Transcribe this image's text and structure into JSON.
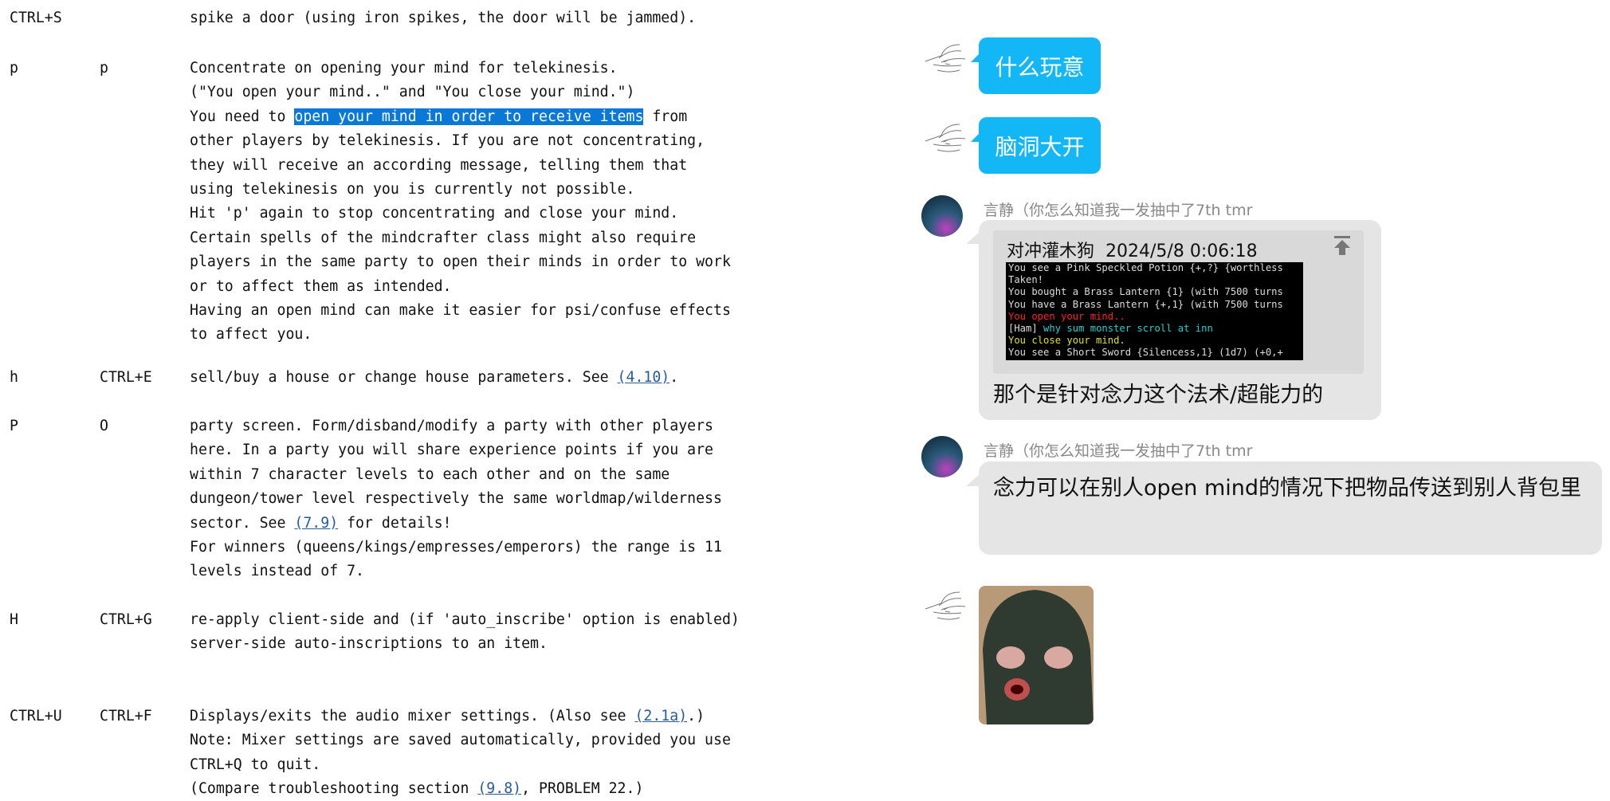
{
  "manual": {
    "sections": [
      {
        "key1": "CTRL+S",
        "key2": "",
        "lines": [
          [
            {
              "t": "spike a door (using iron spikes, the door will be jammed)."
            }
          ]
        ]
      },
      {
        "key1": "p",
        "key2": "p",
        "lines": [
          [
            {
              "t": "Concentrate on opening your mind for telekinesis."
            }
          ],
          [
            {
              "t": "(\"You open your mind..\" and \"You close your mind.\")"
            }
          ],
          [
            {
              "t": "You need to "
            },
            {
              "t": "open your mind in order to receive items",
              "type": "hl"
            },
            {
              "t": " from"
            }
          ],
          [
            {
              "t": "other players by telekinesis. If you are not concentrating,"
            }
          ],
          [
            {
              "t": "they will receive an according message, telling them that"
            }
          ],
          [
            {
              "t": "using telekinesis on you is currently not possible."
            }
          ],
          [
            {
              "t": "Hit 'p' again to stop concentrating and close your mind."
            }
          ],
          [
            {
              "t": "Certain spells of the mindcrafter class might also require"
            }
          ],
          [
            {
              "t": "players in the same party to open their minds in order to work"
            }
          ],
          [
            {
              "t": "or to affect them as intended."
            }
          ],
          [
            {
              "t": "Having an open mind can make it easier for psi/confuse effects"
            }
          ],
          [
            {
              "t": "to affect you."
            }
          ]
        ]
      },
      {
        "key1": "h",
        "key2": "CTRL+E",
        "lines": [
          [
            {
              "t": "sell/buy a house or change house parameters. See "
            },
            {
              "t": "(4.10)",
              "type": "link"
            },
            {
              "t": "."
            }
          ]
        ]
      },
      {
        "key1": "P",
        "key2": "O",
        "lines": [
          [
            {
              "t": "party screen. Form/disband/modify a party with other players"
            }
          ],
          [
            {
              "t": "here. In a party you will share experience points if you are"
            }
          ],
          [
            {
              "t": "within 7 character levels to each other and on the same"
            }
          ],
          [
            {
              "t": "dungeon/tower level respectively the same worldmap/wilderness"
            }
          ],
          [
            {
              "t": "sector. See "
            },
            {
              "t": "(7.9)",
              "type": "link"
            },
            {
              "t": " for details!"
            }
          ],
          [
            {
              "t": "For winners (queens/kings/empresses/emperors) the range is 11"
            }
          ],
          [
            {
              "t": "levels instead of 7."
            }
          ]
        ]
      },
      {
        "key1": "H",
        "key2": "CTRL+G",
        "lines": [
          [
            {
              "t": "re-apply client-side and (if 'auto_inscribe' option is enabled)"
            }
          ],
          [
            {
              "t": "server-side auto-inscriptions to an item."
            }
          ]
        ]
      },
      {
        "key1": "CTRL+U",
        "key2": "CTRL+F",
        "lines": [
          [
            {
              "t": "Displays/exits the audio mixer settings. (Also see "
            },
            {
              "t": "(2.1a)",
              "type": "link"
            },
            {
              "t": ".)"
            }
          ],
          [
            {
              "t": "Note: Mixer settings are saved automatically, provided you use"
            }
          ],
          [
            {
              "t": "CTRL+Q to quit."
            }
          ],
          [
            {
              "t": "(Compare troubleshooting section "
            },
            {
              "t": "(9.8)",
              "type": "link"
            },
            {
              "t": ", PROBLEM 22.)"
            }
          ]
        ]
      }
    ]
  },
  "chat": {
    "msg1": "什么玩意",
    "msg2": "脑洞大开",
    "sender_name": "言静（你怎么知道我一发抽中了7th tmr",
    "quote": {
      "author": "对冲灌木狗",
      "time": "2024/5/8 0:06:18",
      "terminal": [
        {
          "segs": [
            {
              "t": "You see a Pink Speckled Potion {+,?} {worthless",
              "c": "#dddddd"
            }
          ]
        },
        {
          "segs": [
            {
              "t": "Taken!",
              "c": "#dddddd"
            }
          ]
        },
        {
          "segs": [
            {
              "t": "You bought a Brass Lantern {1} (with 7500 turns",
              "c": "#dddddd"
            }
          ]
        },
        {
          "segs": [
            {
              "t": "You have a Brass Lantern {+,1} (with 7500 turns",
              "c": "#dddddd"
            }
          ]
        },
        {
          "segs": [
            {
              "t": "You open your mind..",
              "c": "#ff2020"
            }
          ]
        },
        {
          "segs": [
            {
              "t": "[Ham] ",
              "c": "#dddddd"
            },
            {
              "t": "why sum monster scroll at inn",
              "c": "#20d0d0"
            }
          ]
        },
        {
          "segs": [
            {
              "t": "You close your mind.",
              "c": "#e0e020"
            }
          ]
        },
        {
          "segs": [
            {
              "t": "You see a Short Sword {Silencess,1} (1d7) (+0,+",
              "c": "#dddddd"
            }
          ]
        }
      ]
    },
    "msg3": "那个是针对念力这个法术/超能力的",
    "msg4": "念力可以在别人open mind的情况下把物品传送到别人背包里"
  }
}
